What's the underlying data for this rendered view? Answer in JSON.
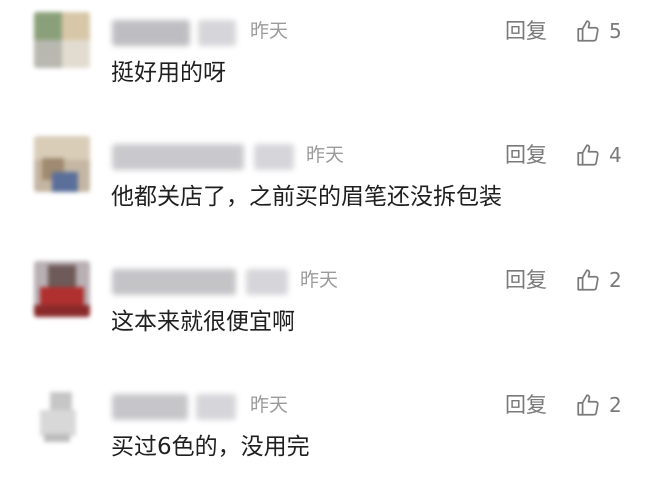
{
  "comments": [
    {
      "time": "昨天",
      "reply_label": "回复",
      "likes": "5",
      "text": "挺好用的呀"
    },
    {
      "time": "昨天",
      "reply_label": "回复",
      "likes": "4",
      "text": "他都关店了，之前买的眉笔还没拆包装"
    },
    {
      "time": "昨天",
      "reply_label": "回复",
      "likes": "2",
      "text": "这本来就很便宜啊"
    },
    {
      "time": "昨天",
      "reply_label": "回复",
      "likes": "2",
      "text": "买过6色的，没用完"
    }
  ],
  "icons": {
    "like": "thumbs-up-icon"
  },
  "colors": {
    "text": "#1f1f1f",
    "muted": "#7a7a7a",
    "time": "#9b9b9b"
  }
}
